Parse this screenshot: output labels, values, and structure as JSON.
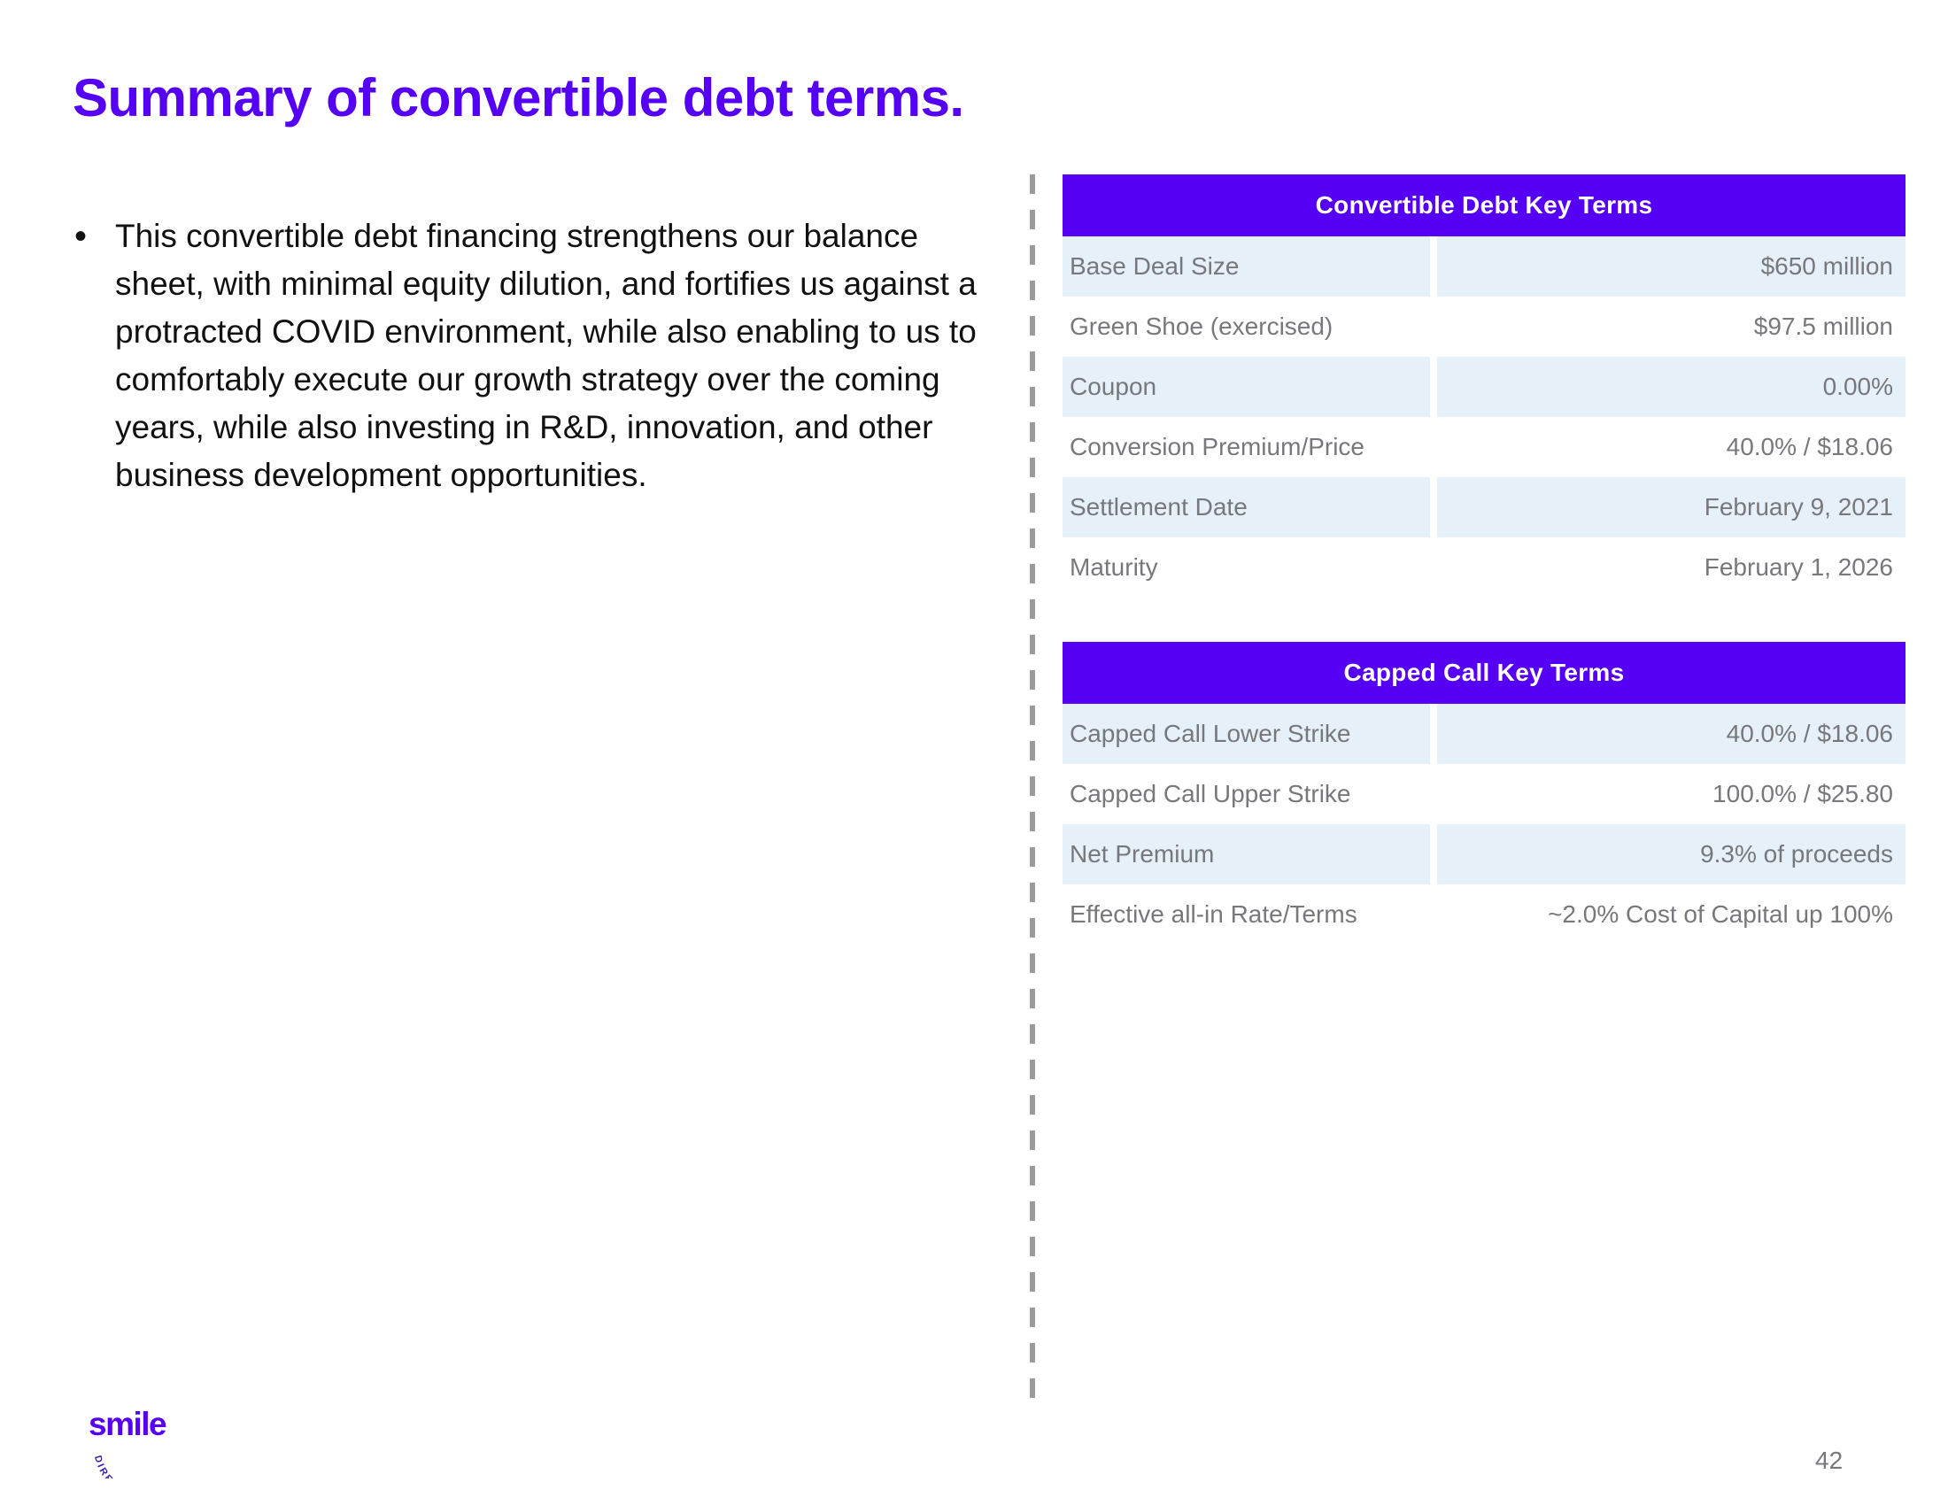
{
  "slide": {
    "title": "Summary of convertible debt terms.",
    "title_color": "#5500F5",
    "page_number": "42",
    "background": "#ffffff"
  },
  "body": {
    "bullet_glyph": "•",
    "bullets": [
      "This convertible debt financing strengthens our balance sheet, with minimal equity dilution, and fortifies us against a protracted COVID environment, while also enabling to us to comfortably execute our growth strategy over the coming years, while also investing in R&D, innovation, and other business development opportunities."
    ]
  },
  "tables": [
    {
      "id": "convertible-debt-key-terms",
      "header": "Convertible Debt Key Terms",
      "header_bg": "#5500F5",
      "header_color": "#ffffff",
      "stripe_color": "#e6f0f9",
      "rows": [
        {
          "label": "Base Deal Size",
          "value": "$650 million"
        },
        {
          "label": "Green Shoe (exercised)",
          "value": "$97.5 million"
        },
        {
          "label": "Coupon",
          "value": "0.00%"
        },
        {
          "label": "Conversion Premium/Price",
          "value": "40.0% / $18.06"
        },
        {
          "label": "Settlement Date",
          "value": "February 9, 2021"
        },
        {
          "label": "Maturity",
          "value": "February 1, 2026"
        }
      ]
    },
    {
      "id": "capped-call-key-terms",
      "header": "Capped Call Key Terms",
      "header_bg": "#5500F5",
      "header_color": "#ffffff",
      "stripe_color": "#e6f0f9",
      "rows": [
        {
          "label": "Capped Call Lower Strike",
          "value": "40.0% / $18.06"
        },
        {
          "label": "Capped Call Upper Strike",
          "value": "100.0% / $25.80"
        },
        {
          "label": "Net Premium",
          "value": "9.3% of proceeds"
        },
        {
          "label": "Effective all-in Rate/Terms",
          "value": "~2.0% Cost of Capital up 100%"
        }
      ]
    }
  ],
  "logo": {
    "wordmark": "smile",
    "tagline": "DIRECT CLUB",
    "color": "#5500F5"
  },
  "divider": {
    "style": "dashed-vertical",
    "color": "#9b9b9b"
  }
}
